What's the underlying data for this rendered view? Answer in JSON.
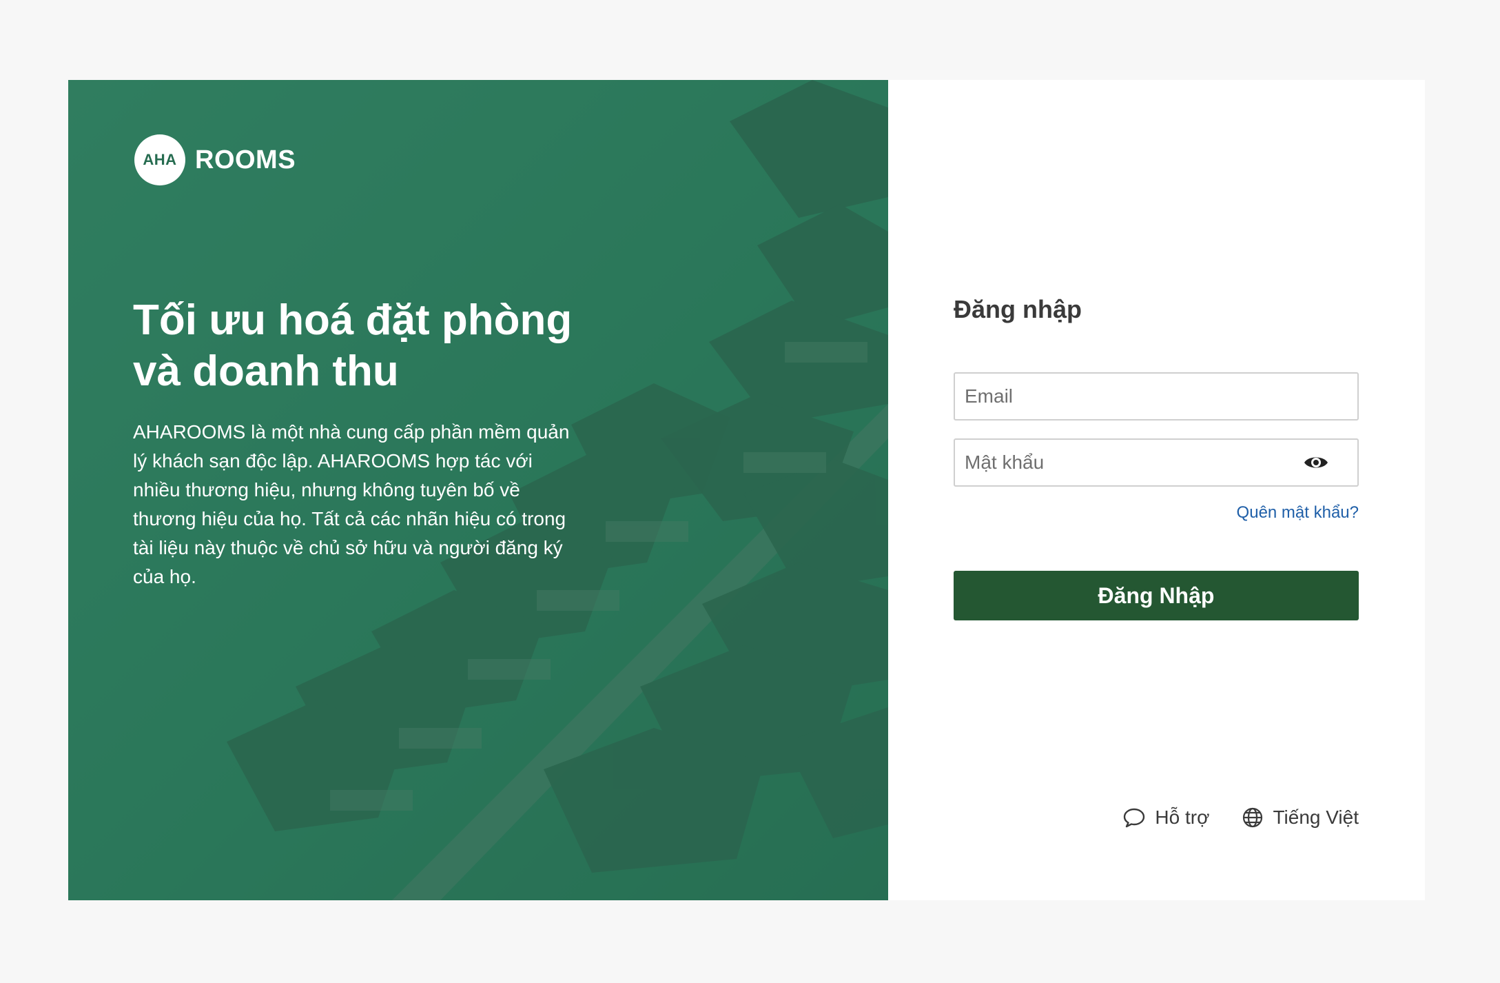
{
  "brand": {
    "logo_mark": "AHA",
    "logo_word": "ROOMS"
  },
  "hero": {
    "title": "Tối ưu hoá đặt phòng và doanh thu",
    "description": "AHAROOMS là một nhà cung cấp phần mềm quản lý khách sạn độc lập. AHAROOMS hợp tác với nhiều thương hiệu, nhưng không tuyên bố về thương hiệu của họ. Tất cả các nhãn hiệu có trong tài liệu này thuộc về chủ sở hữu và người đăng ký của họ."
  },
  "login": {
    "title": "Đăng nhập",
    "email_placeholder": "Email",
    "email_value": "",
    "password_placeholder": "Mật khẩu",
    "password_value": "",
    "forgot_label": "Quên mật khẩu?",
    "submit_label": "Đăng Nhập"
  },
  "footer": {
    "support_label": "Hỗ trợ",
    "language_label": "Tiếng Việt"
  },
  "icons": {
    "eye": "eye-icon",
    "support": "chat-bubble-icon",
    "language": "globe-icon"
  },
  "colors": {
    "hero_overlay": "#287054",
    "button": "#245732",
    "link": "#1f5fa8",
    "page_bg": "#f7f7f7"
  }
}
